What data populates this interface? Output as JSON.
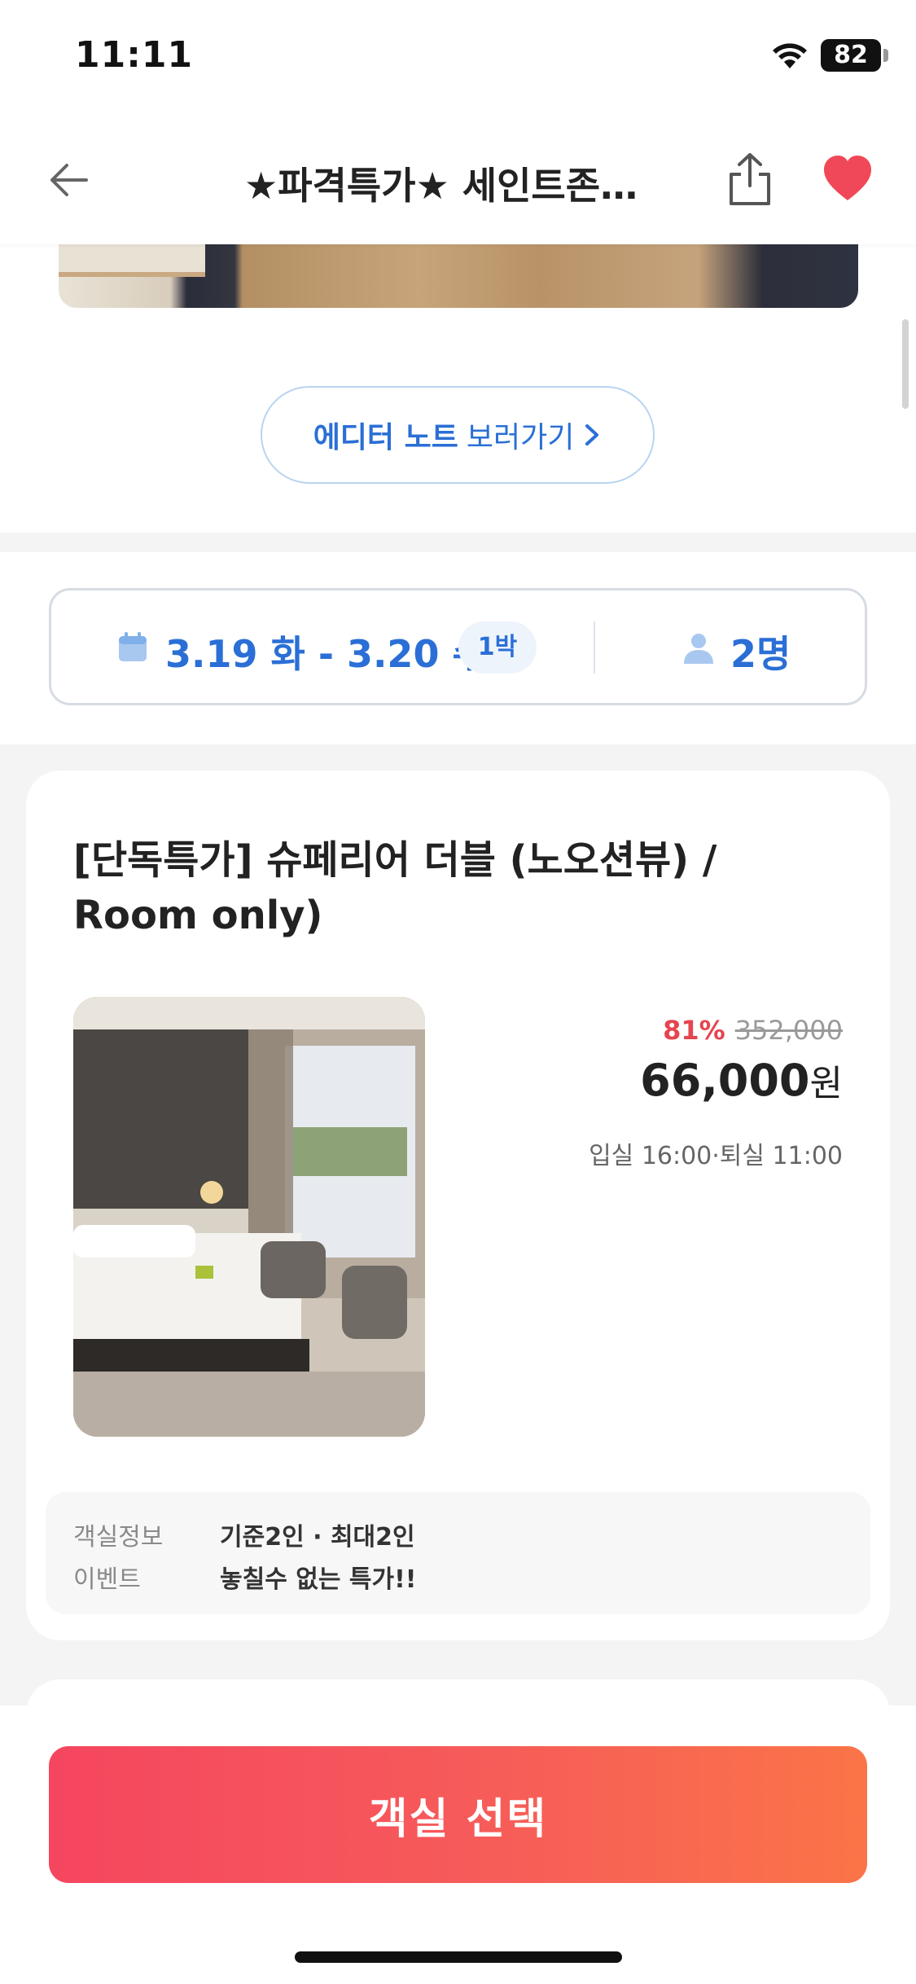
{
  "status_bar": {
    "time": "11:11",
    "battery": "82"
  },
  "header": {
    "title": "★파격특가★ 세인트존스..."
  },
  "editor_note": {
    "strong": "에디터 노트",
    "light": "보러가기"
  },
  "stay": {
    "dates": "3.19 화 - 3.20 수",
    "nights": "1박",
    "guests": "2명"
  },
  "room": {
    "title": "[단독특가] 슈페리어 더블 (노오션뷰) / Room only)",
    "discount": "81%",
    "original_price": "352,000",
    "price": "66,000",
    "currency": "원",
    "checkin_checkout": "입실 16:00·퇴실 11:00",
    "info": [
      {
        "key": "객실정보",
        "value": "기준2인 · 최대2인"
      },
      {
        "key": "이벤트",
        "value": "놓칠수 없는 특가!!"
      }
    ]
  },
  "cta": {
    "label": "객실 선택"
  },
  "colors": {
    "accent_blue": "#2b6fd6",
    "cta_start": "#f5465f",
    "cta_end": "#fb7447",
    "discount_red": "#e5454f",
    "heart": "#f04858"
  }
}
